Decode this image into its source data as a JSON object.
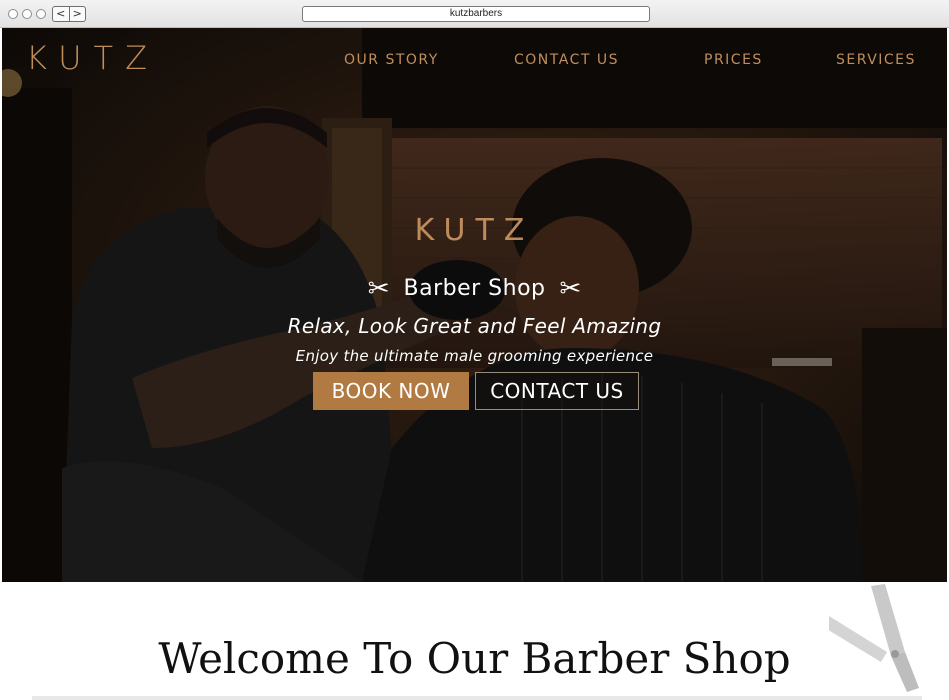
{
  "browser": {
    "url": "kutzbarbers",
    "back_arrow": "<",
    "forward_arrow": ">"
  },
  "header": {
    "logo": "KUTZ",
    "nav": [
      "OUR STORY",
      "CONTACT US",
      "PRICES",
      "SERVICES"
    ]
  },
  "hero": {
    "center_logo": "KUTZ",
    "scissor_glyph": "✂",
    "title": "Barber Shop",
    "subtitle": "Relax, Look Great and Feel Amazing",
    "tagline": "Enjoy the ultimate male grooming experience",
    "buttons": {
      "book": "BOOK NOW",
      "contact": "CONTACT US"
    }
  },
  "welcome": {
    "heading": "Welcome To Our Barber Shop"
  },
  "colors": {
    "accent": "#b27a43",
    "nav_text": "#c08e5c"
  }
}
